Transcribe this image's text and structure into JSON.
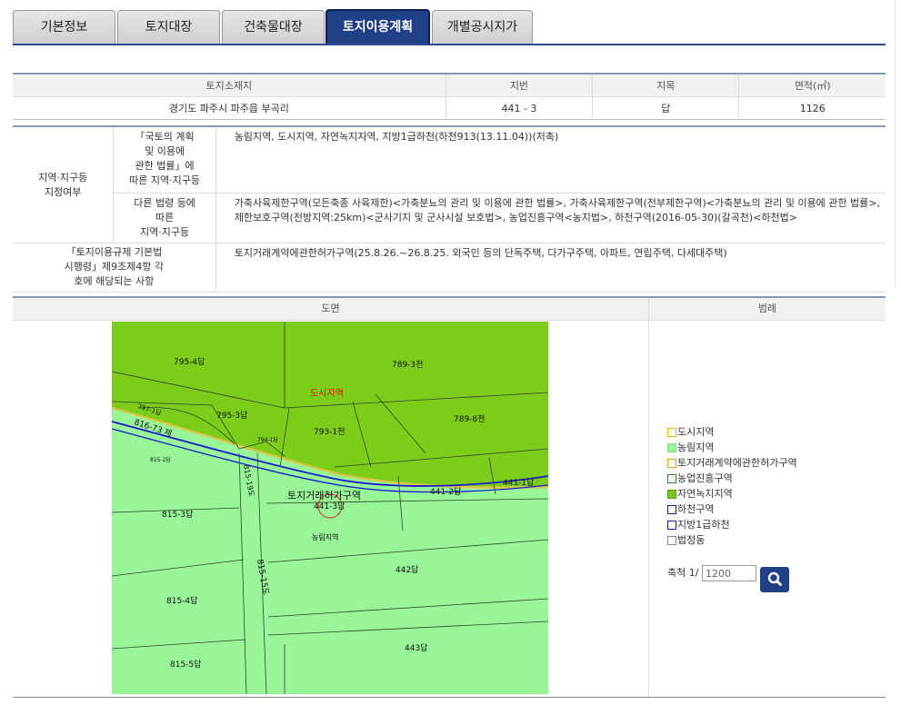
{
  "tabs": [
    {
      "label": "기본정보"
    },
    {
      "label": "토지대장"
    },
    {
      "label": "건축물대장"
    },
    {
      "label": "토지이용계획",
      "active": true
    },
    {
      "label": "개별공시지가"
    }
  ],
  "land_table": {
    "headers": [
      "토지소재지",
      "지번",
      "지목",
      "면적(㎡)"
    ],
    "row": [
      "경기도 파주시 파주읍 부곡리",
      "441 - 3",
      "답",
      "1126"
    ]
  },
  "zoning": {
    "main_label_1": "지역·지구등",
    "main_label_2": "지정여부",
    "sub1_lines": [
      "「국토의 계획",
      "및 이용에",
      "관한 법률」에",
      "따른 지역·지구등"
    ],
    "sub1_value": "농림지역, 도시지역, 자연녹지지역, 지방1급하천(하천913(13.11.04))(저촉)",
    "sub2_lines": [
      "다른 법령 등에",
      "따른",
      "지역·지구등"
    ],
    "sub2_value_1": "가축사육제한구역(모든축종 사육제한)<가축분뇨의 관리 및 이용에 관한 법률>, 가축사육제한구역(전부제한구역)<가축분뇨의 관리 및 이용에 관한 법률>,",
    "sub2_value_2": "제한보호구역(전방지역:25km)<군사기지 및 군사시설 보호법>, 농업진흥구역<농지법>, 하천구역(2016-05-30)(갈곡천)<하천법>",
    "enf_lines": [
      "「토지이용규제 기본법",
      "시행령」제9조제4항 각",
      "호에 해당되는 사항"
    ],
    "enf_value": "토지거래계약에관한허가구역(25.8.26.~26.8.25. 외국인 등의 단독주택, 다가구주택, 아파트, 연립주택, 다세대주택)"
  },
  "map_section": {
    "map_header": "도면",
    "legend_header": "범례",
    "map_labels": {
      "p795_4": "795-4답",
      "p789_3": "789-3천",
      "dohi": "도시지역",
      "p797_1": "797-1답",
      "p795_3": "795-3답",
      "p793_1": "793-1천",
      "p789_8": "789-8천",
      "p816_73": "816-73 제",
      "p794_1": "794-1답",
      "p815_2": "815-2답",
      "p815_19": "815-19도",
      "p441_1": "441-1답",
      "heoga": "토지거래허가구역",
      "p441_3": "441-3답",
      "p441_2": "441-2답",
      "p815_3": "815-3답",
      "nongrim": "농림지역",
      "p815_15": "815-15도",
      "p442": "442답",
      "p815_4": "815-4답",
      "p443": "443답",
      "p815_5": "815-5답"
    },
    "legend": [
      {
        "label": "도시지역",
        "border": "#e8b800",
        "fill": "transparent"
      },
      {
        "label": "농림지역",
        "border": "#7fe07f",
        "fill": "#9af59a"
      },
      {
        "label": "토지거래계약에관한허가구역",
        "border": "#e8a000",
        "fill": "transparent"
      },
      {
        "label": "농업진흥구역",
        "border": "#2a8a2a",
        "fill": "transparent"
      },
      {
        "label": "자연녹지지역",
        "border": "#4aa010",
        "fill": "#7cc61e"
      },
      {
        "label": "하천구역",
        "border": "#1a1a8a",
        "fill": "transparent"
      },
      {
        "label": "지방1급하천",
        "border": "#1a1a8a",
        "fill": "transparent"
      },
      {
        "label": "법정동",
        "border": "#888888",
        "fill": "transparent"
      }
    ],
    "scale_label": "축척 1/",
    "scale_value": "1200"
  }
}
